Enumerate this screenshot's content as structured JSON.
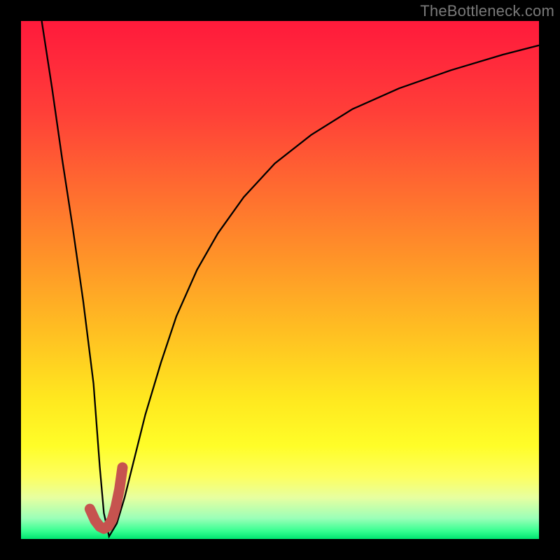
{
  "watermark": "TheBottleneck.com",
  "colors": {
    "frame": "#000000",
    "curve_stroke": "#000000",
    "highlight_stroke": "#c6534f"
  },
  "chart_data": {
    "type": "line",
    "title": "",
    "xlabel": "",
    "ylabel": "",
    "xlim": [
      0,
      100
    ],
    "ylim": [
      0,
      100
    ],
    "grid": false,
    "note": "Axis values are in percent of plot width/height; y measured from top (0) to bottom (100). Curve is a V-shaped bottleneck profile with a logarithmic rise on the right branch.",
    "series": [
      {
        "name": "bottleneck-curve",
        "color": "#000000",
        "x": [
          4,
          6,
          8,
          10,
          12,
          14,
          15.2,
          16,
          17,
          18.5,
          20,
          22,
          24,
          27,
          30,
          34,
          38,
          43,
          49,
          56,
          64,
          73,
          83,
          93,
          100
        ],
        "y": [
          0,
          13,
          27,
          40,
          54,
          70,
          86,
          95,
          99.5,
          97,
          92,
          84,
          76,
          66,
          57,
          48,
          41,
          34,
          27.5,
          22,
          17,
          13,
          9.5,
          6.5,
          4.7
        ]
      },
      {
        "name": "highlight-J",
        "color": "#c6534f",
        "stroke_width_px": 15,
        "linecap": "round",
        "x": [
          13.3,
          14.3,
          15.2,
          16.0,
          16.8,
          17.6,
          18.3,
          19.0,
          19.6
        ],
        "y": [
          94.2,
          96.4,
          97.6,
          98.0,
          97.6,
          96.2,
          93.8,
          90.4,
          86.2
        ]
      }
    ]
  }
}
